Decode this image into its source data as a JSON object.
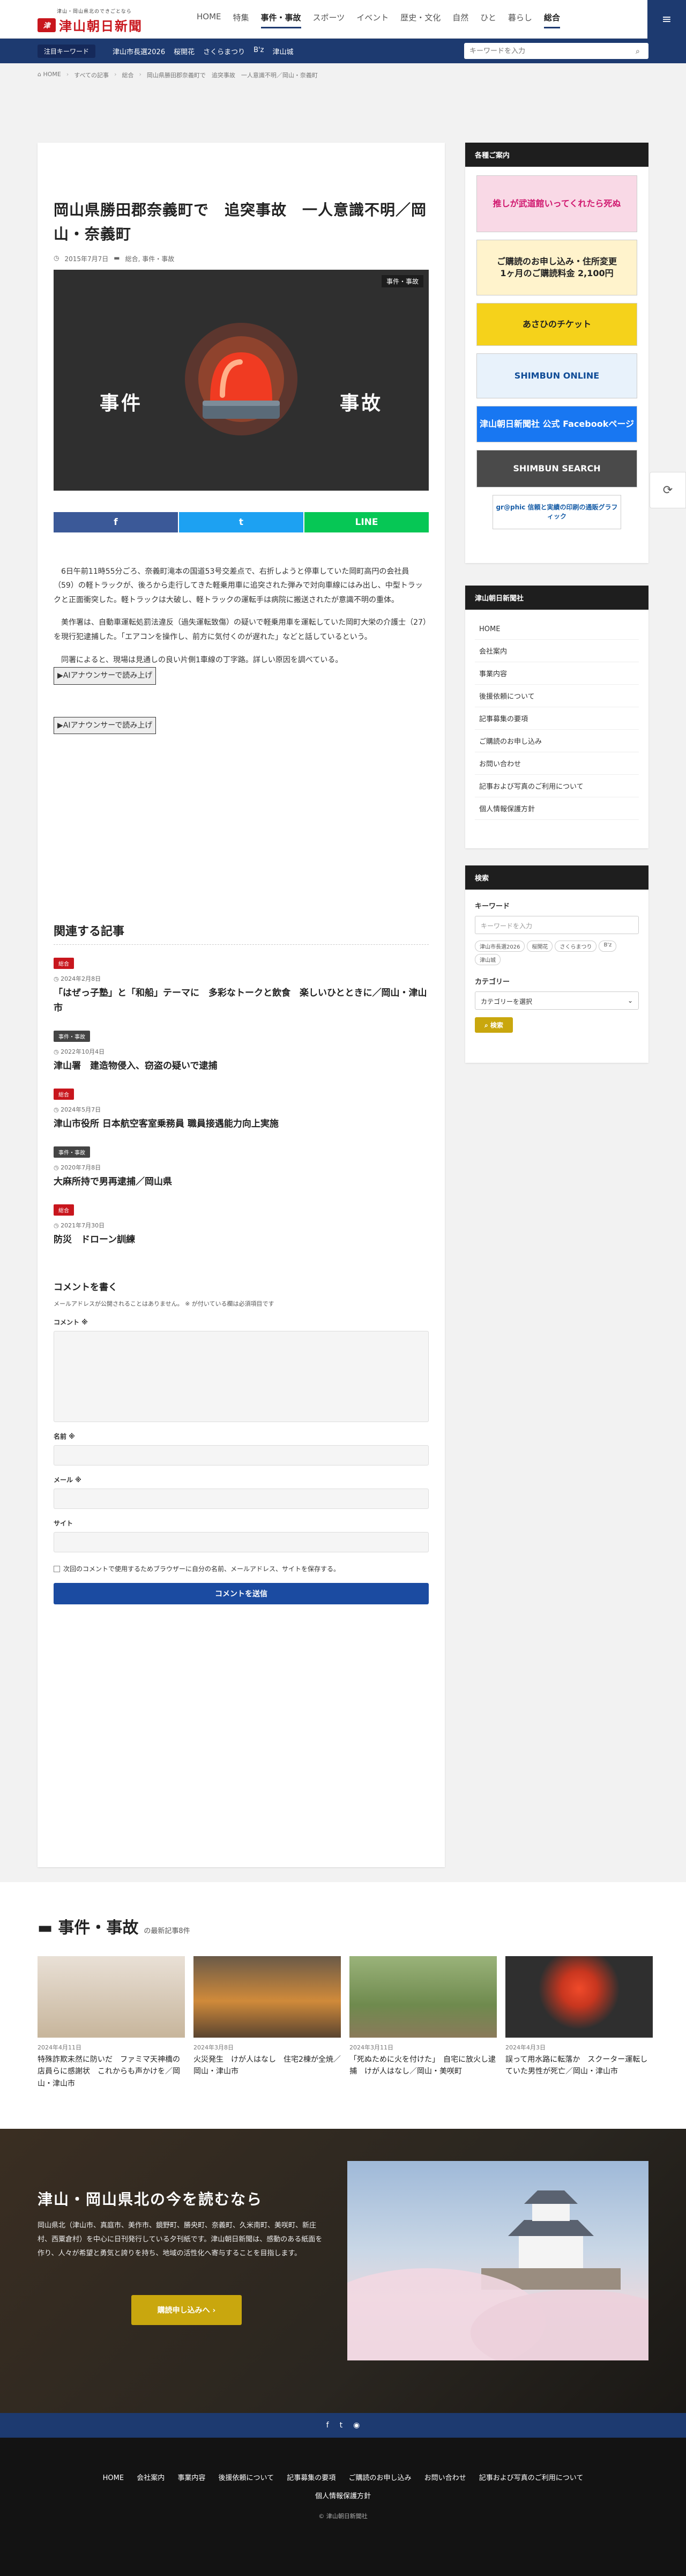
{
  "header": {
    "tagline": "津山・岡山県北のできごとなら",
    "logo_mark": "津",
    "logo_name": "津山朝日新聞",
    "nav": [
      "HOME",
      "特集",
      "事件・事故",
      "スポーツ",
      "イベント",
      "歴史・文化",
      "自然",
      "ひと",
      "暮らし",
      "総合"
    ],
    "menu_icon": "≡"
  },
  "keyword_bar": {
    "label": "注目キーワード",
    "links": [
      "津山市長選2026",
      "桜開花",
      "さくらまつり",
      "B'z",
      "津山城"
    ],
    "search_placeholder": "キーワードを入力"
  },
  "breadcrumb": [
    "HOME",
    "すべての記事",
    "総合",
    "岡山県勝田郡奈義町で　追突事故　一人意識不明／岡山・奈義町"
  ],
  "article": {
    "title": "岡山県勝田郡奈義町で　追突事故　一人意識不明／岡山・奈義町",
    "date": "2015年7月7日",
    "categories": "総合, 事件・事故",
    "hero_tag": "事件・事故",
    "hero_left": "事件",
    "hero_right": "事故",
    "share": {
      "fb": "f",
      "tw": "t",
      "line": "LINE"
    },
    "paragraphs": [
      "6日午前11時55分ごろ、奈義町滝本の国道53号交差点で、右折しようと停車していた岡町高円の会社員（59）の軽トラックが、後ろから走行してきた軽乗用車に追突された弾みで対向車線にはみ出し、中型トラックと正面衝突した。軽トラックは大破し、軽トラックの運転手は病院に搬送されたが意識不明の重体。",
      "美作署は、自動車運転処罰法違反（過失運転致傷）の疑いで軽乗用車を運転していた岡町大栄の介護士（27）を現行犯逮捕した。「エアコンを操作し、前方に気付くのが遅れた」などと話しているという。",
      "同署によると、現場は見通しの良い片側1車線の丁字路。詳しい原因を調べている。"
    ],
    "ai_button": "▶AIアナウンサーで読み上げ"
  },
  "related": {
    "heading": "関連する記事",
    "items": [
      {
        "tag": "総合",
        "date": "2024年2月8日",
        "title": "「はぜっ子塾」と「和船」テーマに　多彩なトークと飲食　楽しいひとときに／岡山・津山市"
      },
      {
        "tag": "事件・事故",
        "date": "2022年10月4日",
        "title": "津山署　建造物侵入、窃盗の疑いで逮捕"
      },
      {
        "tag": "総合",
        "date": "2024年5月7日",
        "title": "津山市役所 日本航空客室乗務員 職員接遇能力向上実施"
      },
      {
        "tag": "事件・事故",
        "date": "2020年7月8日",
        "title": "大麻所持で男再逮捕／岡山県"
      },
      {
        "tag": "総合",
        "date": "2021年7月30日",
        "title": "防災　ドローン訓練"
      }
    ]
  },
  "comment": {
    "heading": "コメントを書く",
    "note": "メールアドレスが公開されることはありません。 ※ が付いている欄は必須項目です",
    "labels": {
      "comment": "コメント ※",
      "name": "名前 ※",
      "email": "メール ※",
      "site": "サイト"
    },
    "save_info": "次回のコメントで使用するためブラウザーに自分の名前、メールアドレス、サイトを保存する。",
    "submit": "コメントを送信"
  },
  "sidebar": {
    "info_heading": "各種ご案内",
    "banners": [
      {
        "text": "推しが武道館いってくれたら死ぬ",
        "bg": "#f9d9e6",
        "color": "#d0186f"
      },
      {
        "text": "ご購読のお申し込み・住所変更\n1ヶ月のご購読料金 2,100円",
        "bg": "#fff3cc",
        "color": "#222"
      },
      {
        "text": "あさひのチケット",
        "bg": "#f5d21b",
        "color": "#222"
      },
      {
        "text": "SHIMBUN ONLINE",
        "bg": "#e8f2fb",
        "color": "#0f4c97"
      },
      {
        "text": "津山朝日新聞社 公式 Facebookページ",
        "bg": "#1877f2",
        "color": "#ffffff"
      },
      {
        "text": "SHIMBUN SEARCH",
        "bg": "#4a4a4a",
        "color": "#ffffff"
      },
      {
        "text": "gr@phic 信頼と実績の印刷の通販グラフィック",
        "bg": "#ffffff",
        "color": "#1a5fa8"
      }
    ],
    "company_heading": "津山朝日新聞社",
    "company_links": [
      "HOME",
      "会社案内",
      "事業内容",
      "後援依頼について",
      "記事募集の要項",
      "ご購読のお申し込み",
      "お問い合わせ",
      "記事および写真のご利用について",
      "個人情報保護方針"
    ],
    "search_heading": "検索",
    "keyword_label": "キーワード",
    "keyword_placeholder": "キーワードを入力",
    "tags": [
      "津山市長選2026",
      "桜開花",
      "さくらまつり",
      "B'z",
      "津山城"
    ],
    "category_label": "カテゴリー",
    "category_select": "カテゴリーを選択",
    "search_button": "検索"
  },
  "latest": {
    "title": "事件・事故",
    "subtitle": "の最新記事8件",
    "cards": [
      {
        "date": "2024年4月11日",
        "title": "特殊詐欺未然に防いだ　ファミマ天神橋の店員らに感謝状　これからも声かけを／岡山・津山市"
      },
      {
        "date": "2024年3月8日",
        "title": "火災発生　けが人はなし　住宅2棟が全焼／岡山・津山市"
      },
      {
        "date": "2024年3月11日",
        "title": "「死ぬために火を付けた」　自宅に放火し逮捕　けが人はなし／岡山・美咲町"
      },
      {
        "date": "2024年4月3日",
        "title": "誤って用水路に転落か　スクーター運転していた男性が死亡／岡山・津山市"
      }
    ]
  },
  "promo": {
    "title": "津山・岡山県北の今を読むなら",
    "text": "岡山県北（津山市、真庭市、美作市、鏡野町、勝央町、奈義町、久米南町、美咲町、新庄村、西粟倉村）を中心に日刊発行している夕刊紙です。津山朝日新聞は、感動のある紙面を作り、人々が希望と勇気と誇りを持ち、地域の活性化へ寄与することを目指します。",
    "button": "購読申し込みへ ›"
  },
  "footer": {
    "social": [
      "f",
      "t",
      "RSS"
    ],
    "nav": [
      "HOME",
      "会社案内",
      "事業内容",
      "後援依頼について",
      "記事募集の要項",
      "ご購読のお申し込み",
      "お問い合わせ",
      "記事および写真のご利用について",
      "個人情報保護方針"
    ],
    "copyright": "© 津山朝日新聞社"
  },
  "colors": {
    "navy": "#1d3a70",
    "red": "#c8161d",
    "gold": "#c9a70e"
  }
}
